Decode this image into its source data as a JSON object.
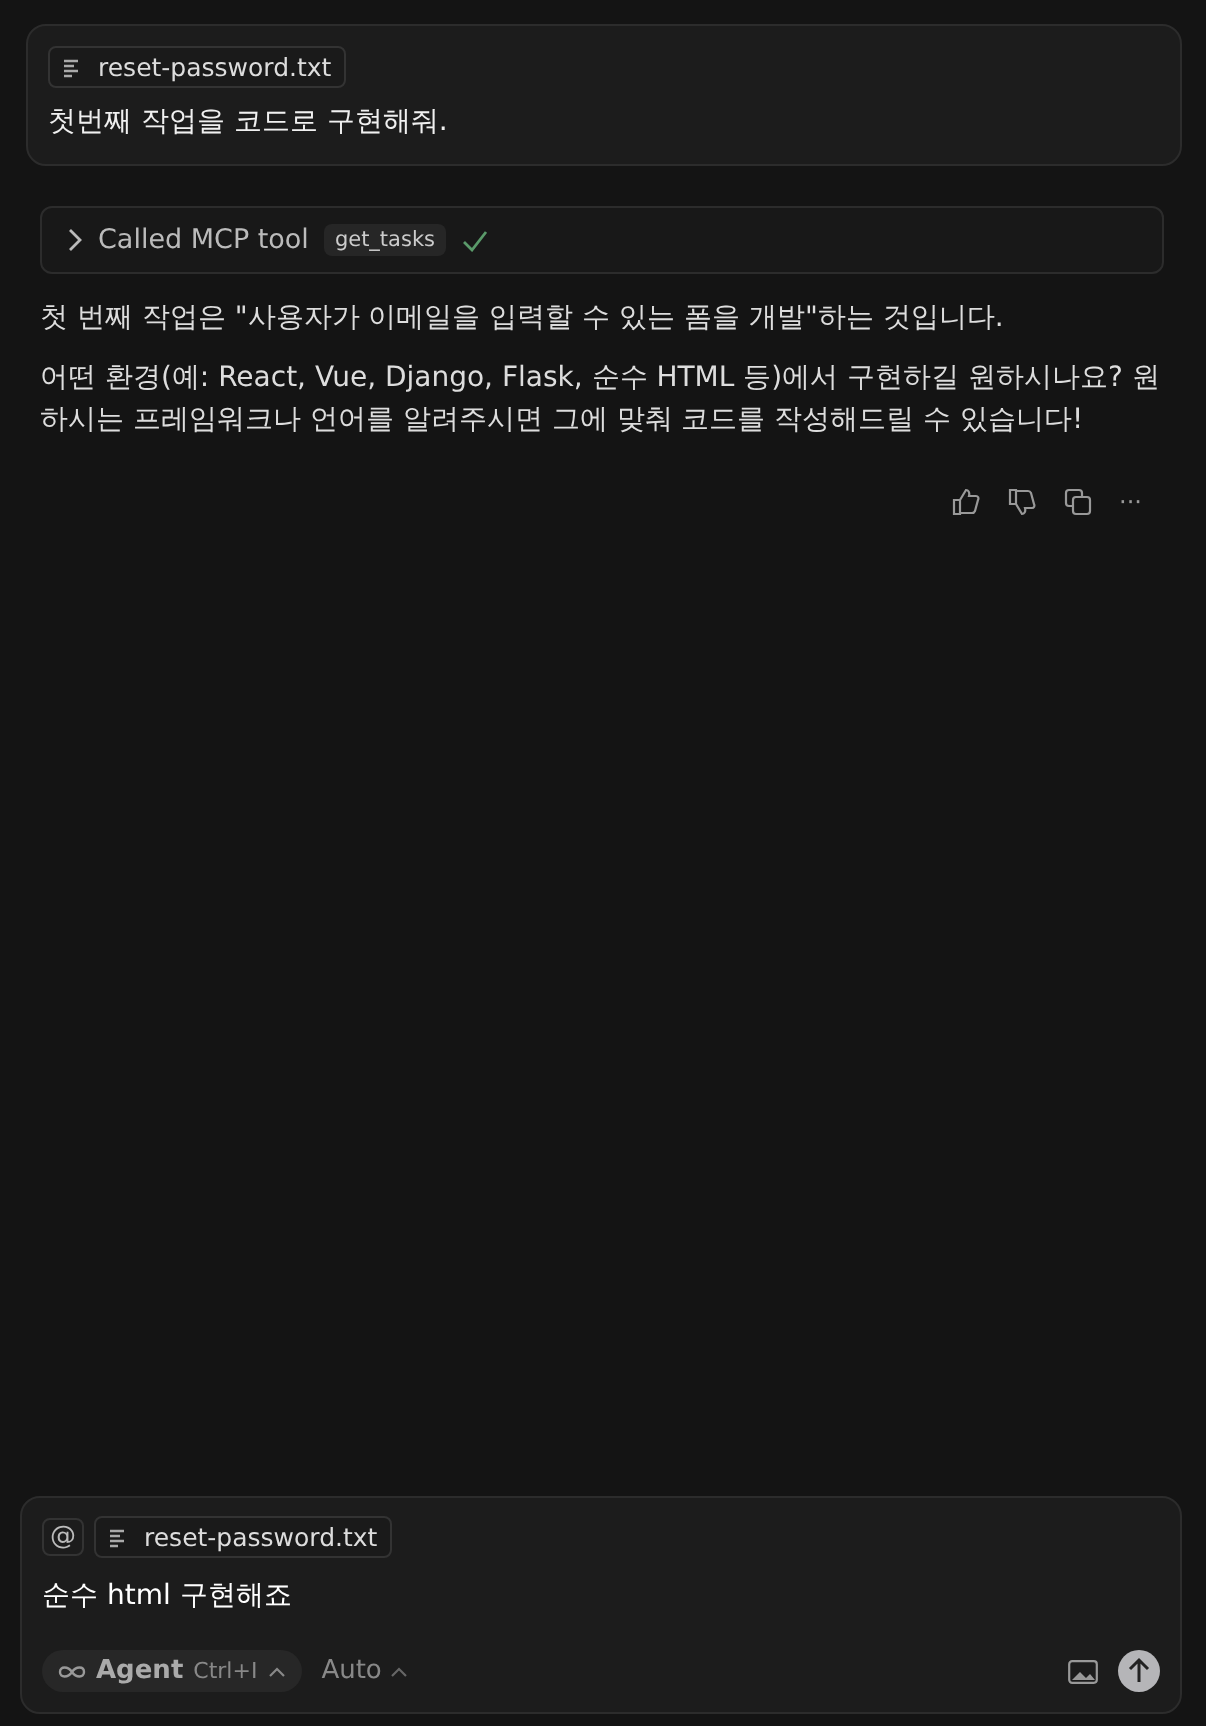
{
  "user_message": {
    "attachment": "reset-password.txt",
    "text": "첫번째 작업을 코드로 구현해줘."
  },
  "tool_call": {
    "label": "Called MCP tool",
    "tool": "get_tasks",
    "succeeded": true
  },
  "response": {
    "paragraphs": [
      "첫 번째 작업은 \"사용자가 이메일을 입력할 수 있는 폼을 개발\"하는 것입니다.",
      "어떤 환경(예: React, Vue, Django, Flask, 순수 HTML 등)에서 구현하길 원하시나요? 원하시는 프레임워크나 언어를 알려주시면 그에 맞춰 코드를 작성해드릴 수 있습니다!"
    ],
    "more": "···"
  },
  "composer": {
    "mention": "@",
    "attachment": "reset-password.txt",
    "value": "순수 html 구현해죠",
    "mode": "Agent",
    "shortcut": "Ctrl+I",
    "model": "Auto"
  }
}
